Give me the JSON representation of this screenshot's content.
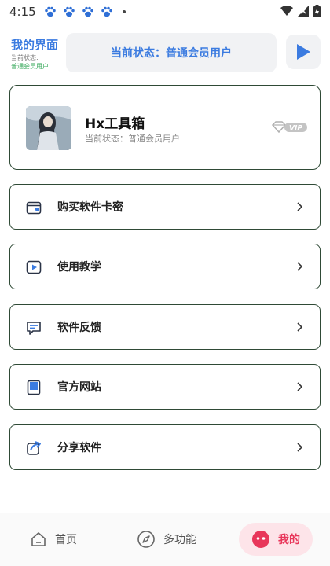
{
  "status_bar": {
    "time": "4:15"
  },
  "header": {
    "title": "我的界面",
    "sub_label": "当前状态:",
    "sub_value": "普通会员用户",
    "status_text": "当前状态：普通会员用户"
  },
  "profile": {
    "name": "Hx工具箱",
    "status": "当前状态：普通会员用户",
    "badge": "VIP"
  },
  "menu": [
    {
      "label": "购买软件卡密",
      "icon": "wallet-icon"
    },
    {
      "label": "使用教学",
      "icon": "play-video-icon"
    },
    {
      "label": "软件反馈",
      "icon": "feedback-icon"
    },
    {
      "label": "官方网站",
      "icon": "bookmark-icon"
    },
    {
      "label": "分享软件",
      "icon": "share-icon"
    }
  ],
  "bottom_nav": {
    "items": [
      {
        "label": "首页",
        "icon": "home-icon"
      },
      {
        "label": "多功能",
        "icon": "compass-icon"
      },
      {
        "label": "我的",
        "icon": "profile-face-icon",
        "active": true
      }
    ]
  },
  "colors": {
    "accent_blue": "#3b7be0",
    "accent_green": "#36a85a",
    "accent_pink": "#e8365a",
    "card_border": "#2f4a36"
  }
}
